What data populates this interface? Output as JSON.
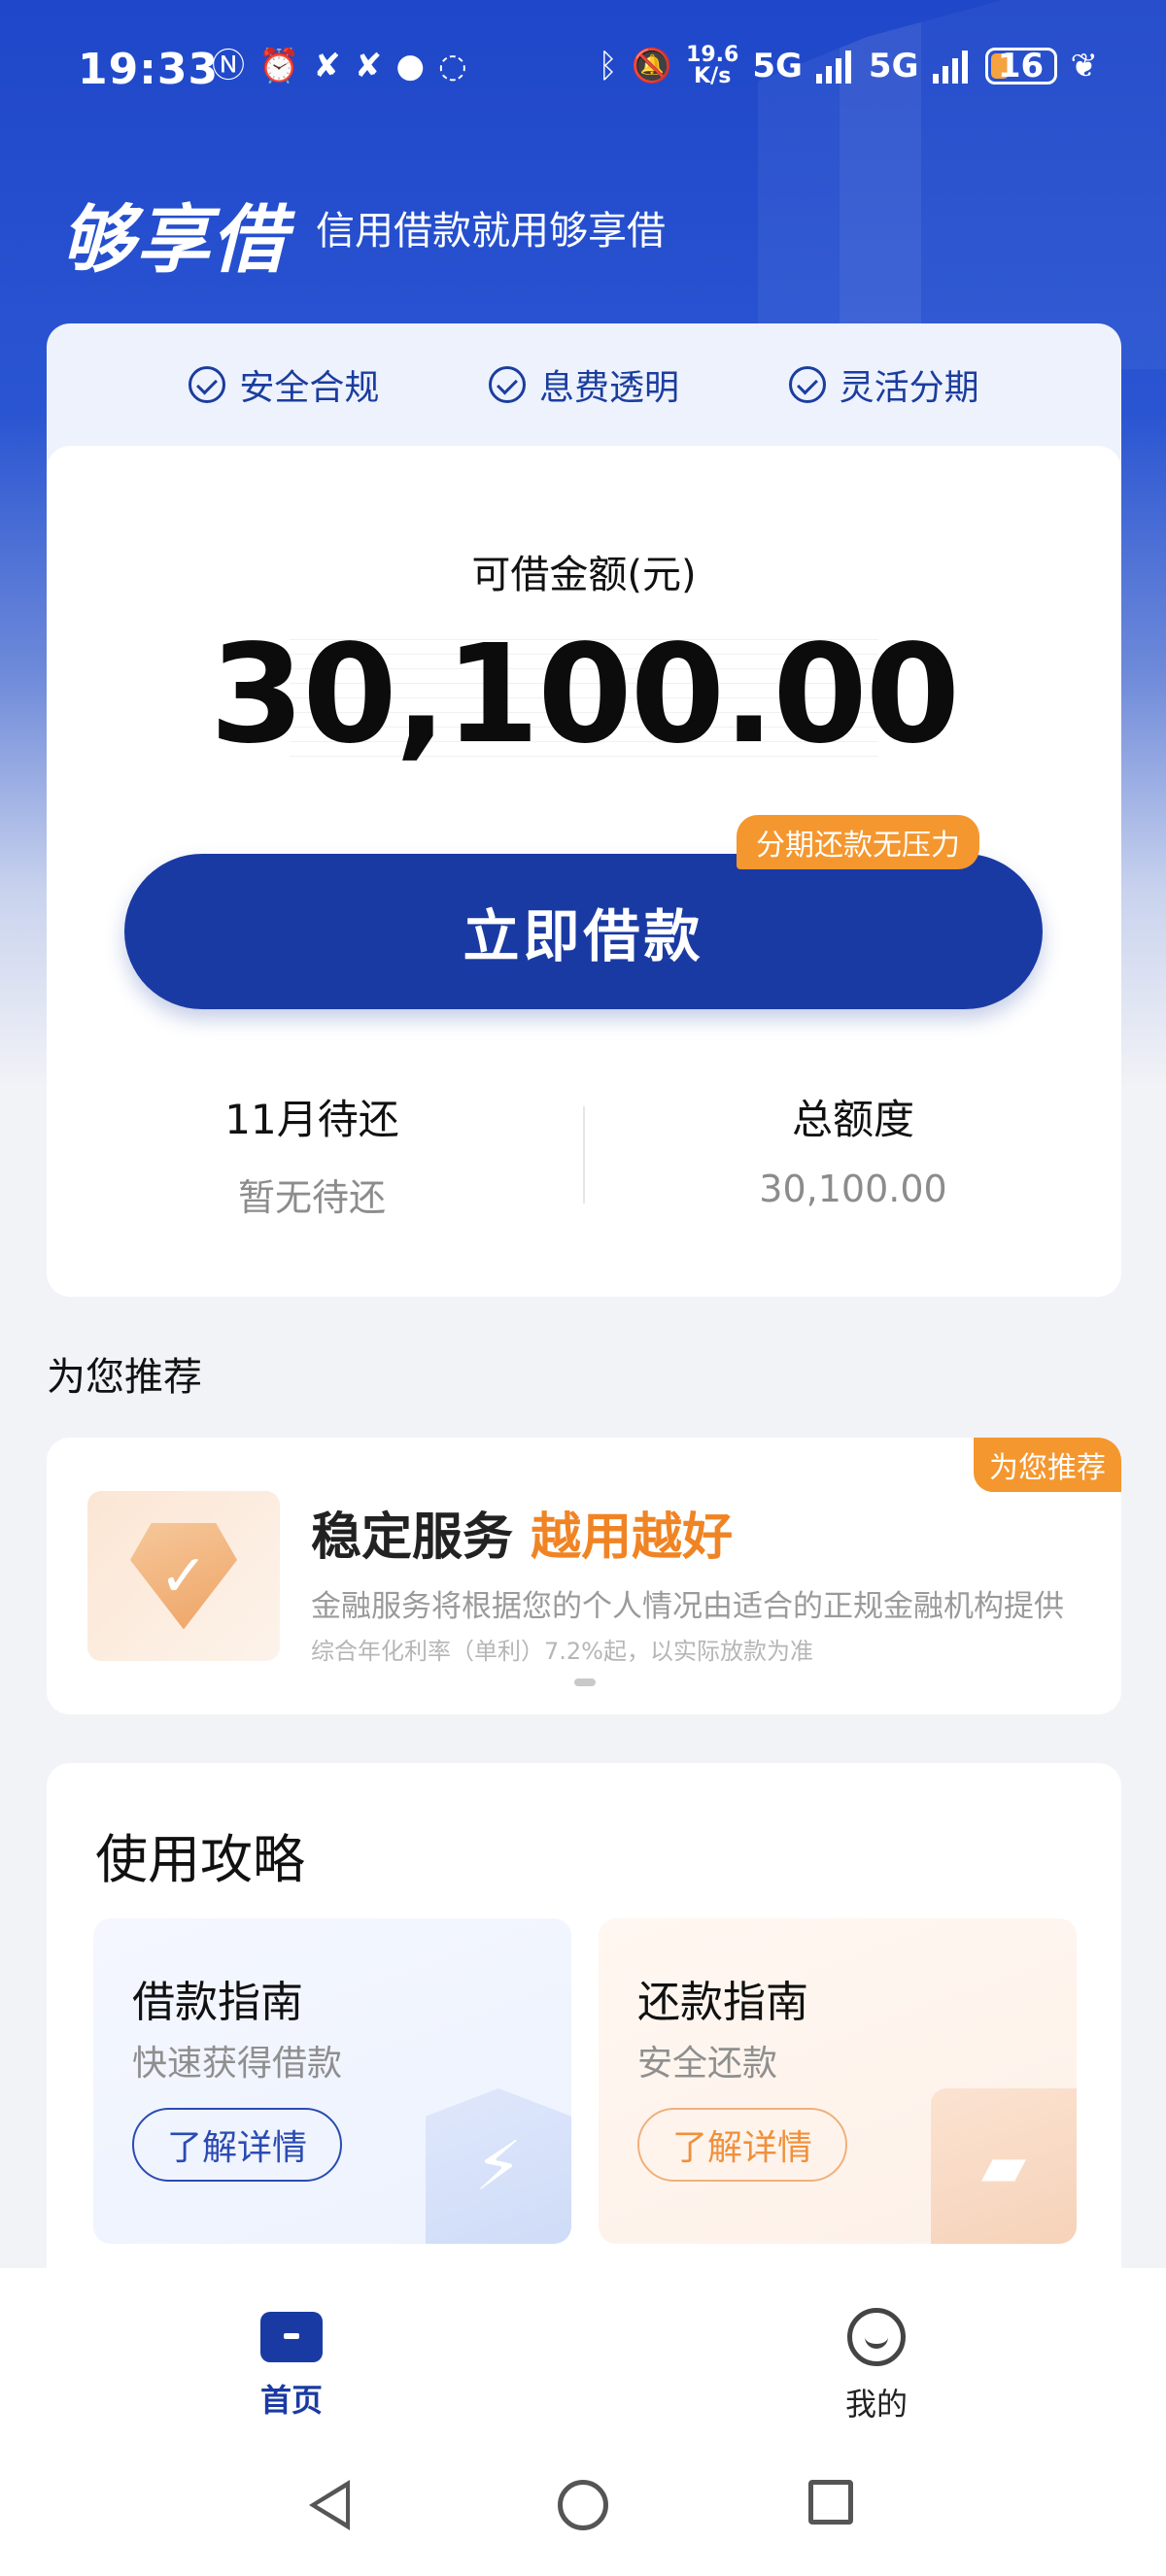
{
  "status_bar": {
    "time": "19:33",
    "net_speed_value": "19.6",
    "net_speed_unit": "K/s",
    "net_type_1": "5G",
    "net_type_2": "5G",
    "battery": "16"
  },
  "header": {
    "brand": "够享借",
    "slogan": "信用借款就用够享借"
  },
  "features": [
    {
      "label": "安全合规"
    },
    {
      "label": "息费透明"
    },
    {
      "label": "灵活分期"
    }
  ],
  "loan": {
    "available_label": "可借金额(元)",
    "available_amount": "30,100.00",
    "borrow_button": "立即借款",
    "promo_tag": "分期还款无压力",
    "due_title": "11月待还",
    "due_value": "暂无待还",
    "limit_title": "总额度",
    "limit_value": "30,100.00"
  },
  "recommend": {
    "section_title": "为您推荐",
    "badge": "为您推荐",
    "headline_main": "稳定服务",
    "headline_accent": "越用越好",
    "desc": "金融服务将根据您的个人情况由适合的正规金融机构提供",
    "rate_note": "综合年化利率（单利）7.2%起，以实际放款为准"
  },
  "guide": {
    "title": "使用攻略",
    "cards": [
      {
        "title": "借款指南",
        "subtitle": "快速获得借款",
        "button": "了解详情"
      },
      {
        "title": "还款指南",
        "subtitle": "安全还款",
        "button": "了解详情"
      }
    ]
  },
  "tabbar": {
    "home": "首页",
    "mine": "我的"
  },
  "colors": {
    "primary": "#1a3aa3",
    "accent_orange": "#f4972f",
    "header_blue": "#1f47c9"
  }
}
